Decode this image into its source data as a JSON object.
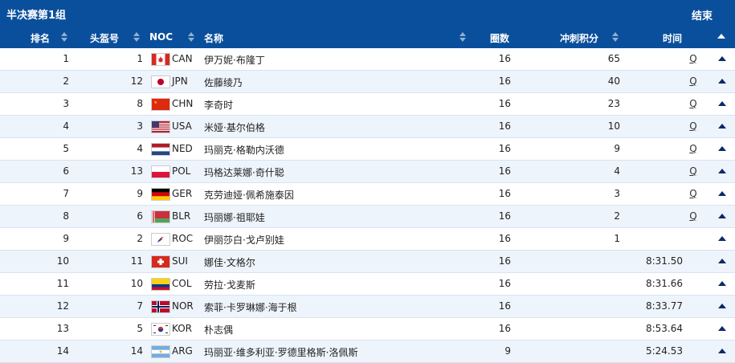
{
  "header": {
    "title": "半决赛第1组",
    "status": "结束"
  },
  "columns": {
    "rank": "排名",
    "bib": "头盔号",
    "noc": "NOC",
    "name": "名称",
    "laps": "圈数",
    "points": "冲刺积分",
    "time": "时间"
  },
  "rows": [
    {
      "rank": "1",
      "bib": "1",
      "noc": "CAN",
      "name": "伊万妮·布隆丁",
      "laps": "16",
      "points": "65",
      "time": "",
      "q": "Q"
    },
    {
      "rank": "2",
      "bib": "12",
      "noc": "JPN",
      "name": "佐藤绫乃",
      "laps": "16",
      "points": "40",
      "time": "",
      "q": "Q"
    },
    {
      "rank": "3",
      "bib": "8",
      "noc": "CHN",
      "name": "李奇时",
      "laps": "16",
      "points": "23",
      "time": "",
      "q": "Q"
    },
    {
      "rank": "4",
      "bib": "3",
      "noc": "USA",
      "name": "米娅·基尔伯格",
      "laps": "16",
      "points": "10",
      "time": "",
      "q": "Q"
    },
    {
      "rank": "5",
      "bib": "4",
      "noc": "NED",
      "name": "玛丽克·格勒内沃德",
      "laps": "16",
      "points": "9",
      "time": "",
      "q": "Q"
    },
    {
      "rank": "6",
      "bib": "13",
      "noc": "POL",
      "name": "玛格达莱娜·奇什聪",
      "laps": "16",
      "points": "4",
      "time": "",
      "q": "Q"
    },
    {
      "rank": "7",
      "bib": "9",
      "noc": "GER",
      "name": "克劳迪娅·佩希施泰因",
      "laps": "16",
      "points": "3",
      "time": "",
      "q": "Q"
    },
    {
      "rank": "8",
      "bib": "6",
      "noc": "BLR",
      "name": "玛丽娜·祖耶娃",
      "laps": "16",
      "points": "2",
      "time": "",
      "q": "Q"
    },
    {
      "rank": "9",
      "bib": "2",
      "noc": "ROC",
      "name": "伊丽莎白·戈卢别娃",
      "laps": "16",
      "points": "1",
      "time": "",
      "q": ""
    },
    {
      "rank": "10",
      "bib": "11",
      "noc": "SUI",
      "name": "娜佳·文格尔",
      "laps": "16",
      "points": "",
      "time": "8:31.50",
      "q": ""
    },
    {
      "rank": "11",
      "bib": "10",
      "noc": "COL",
      "name": "劳拉·戈麦斯",
      "laps": "16",
      "points": "",
      "time": "8:31.66",
      "q": ""
    },
    {
      "rank": "12",
      "bib": "7",
      "noc": "NOR",
      "name": "索菲·卡罗琳娜·海于根",
      "laps": "16",
      "points": "",
      "time": "8:33.77",
      "q": ""
    },
    {
      "rank": "13",
      "bib": "5",
      "noc": "KOR",
      "name": "朴志偶",
      "laps": "16",
      "points": "",
      "time": "8:53.64",
      "q": ""
    },
    {
      "rank": "14",
      "bib": "14",
      "noc": "ARG",
      "name": "玛丽亚·维多利亚·罗德里格斯·洛佩斯",
      "laps": "9",
      "points": "",
      "time": "5:24.53",
      "q": ""
    }
  ]
}
